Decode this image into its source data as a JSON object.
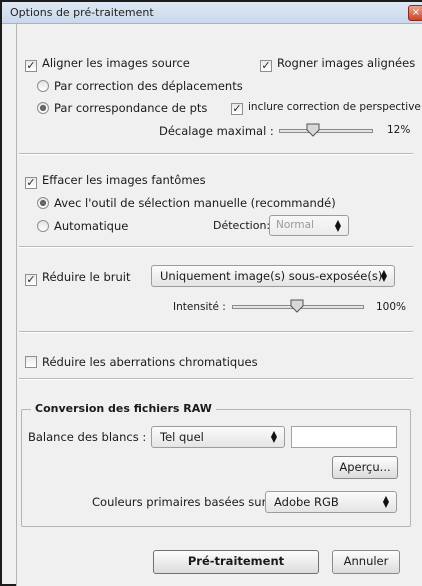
{
  "window": {
    "title": "Options de pré-traitement",
    "close_glyph": "×"
  },
  "align": {
    "label": "Aligner les images source",
    "checked": true,
    "crop_label": "Rogner images alignées",
    "by_displacement": "Par correction des déplacements",
    "by_points": "Par correspondance de pts",
    "perspective_label": "inclure correction de perspective",
    "max_offset_label": "Décalage maximal :",
    "max_offset_value": "12%",
    "max_offset_level": 0.12
  },
  "ghosts": {
    "label": "Effacer les images fantômes",
    "manual": "Avec l'outil de sélection manuelle (recommandé)",
    "automatic": "Automatique",
    "detection_label": "Détection:",
    "detection_value": "Normal"
  },
  "noise": {
    "label": "Réduire le bruit",
    "mode_value": "Uniquement image(s) sous-exposée(s)",
    "intensity_label": "Intensité :",
    "intensity_value": "100%",
    "intensity_level": 1.0
  },
  "chromatic": {
    "label": "Réduire les aberrations chromatiques"
  },
  "raw": {
    "legend": "Conversion des fichiers RAW",
    "wb_label": "Balance des blancs :",
    "wb_value": "Tel quel",
    "preview_button": "Aperçu...",
    "primaries_label": "Couleurs primaires basées sur",
    "primaries_value": "Adobe RGB"
  },
  "footer": {
    "ok_button": "Pré-traitement",
    "cancel_button": "Annuler"
  },
  "glyphs": {
    "check": "✓",
    "dropdown": "▲▼"
  },
  "icons": {
    "close": "close-icon",
    "check": "checkmark-icon",
    "dropdown": "dropdown-arrows-icon",
    "slider": "slider-thumb-icon"
  }
}
